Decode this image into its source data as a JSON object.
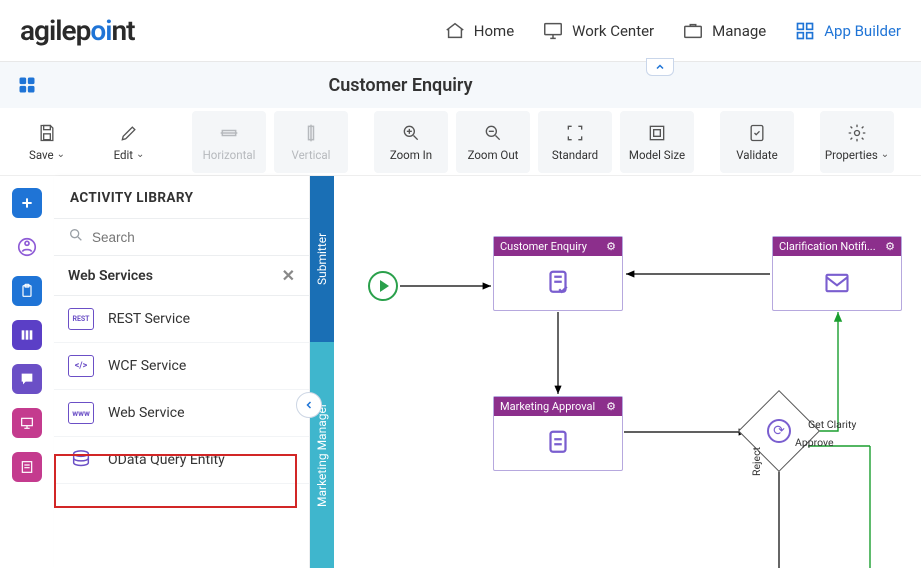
{
  "header": {
    "logo_pre": "agilep",
    "logo_oi": "oi",
    "logo_post": "nt",
    "nav": {
      "home": "Home",
      "work_center": "Work Center",
      "manage": "Manage",
      "app_builder": "App Builder"
    }
  },
  "page": {
    "title": "Customer Enquiry"
  },
  "toolbar": {
    "save": "Save",
    "edit": "Edit",
    "horizontal": "Horizontal",
    "vertical": "Vertical",
    "zoom_in": "Zoom In",
    "zoom_out": "Zoom Out",
    "standard": "Standard",
    "model_size": "Model Size",
    "validate": "Validate",
    "properties": "Properties"
  },
  "sidebar": {
    "title": "ACTIVITY LIBRARY",
    "search_placeholder": "Search",
    "section": "Web Services",
    "items": [
      "REST Service",
      "WCF Service",
      "Web Service",
      "OData Query Entity"
    ],
    "item_codes": [
      "REST",
      "</>",
      "www",
      "DB"
    ]
  },
  "lanes": {
    "l1": "Submitter",
    "l2": "Marketing Manager"
  },
  "tasks": {
    "t1": "Customer Enquiry",
    "t2": "Marketing Approval",
    "t3": "Clarification Notifi..."
  },
  "edge_labels": {
    "clarity": "Get Clarity",
    "approve": "Approve",
    "reject": "Reject"
  }
}
